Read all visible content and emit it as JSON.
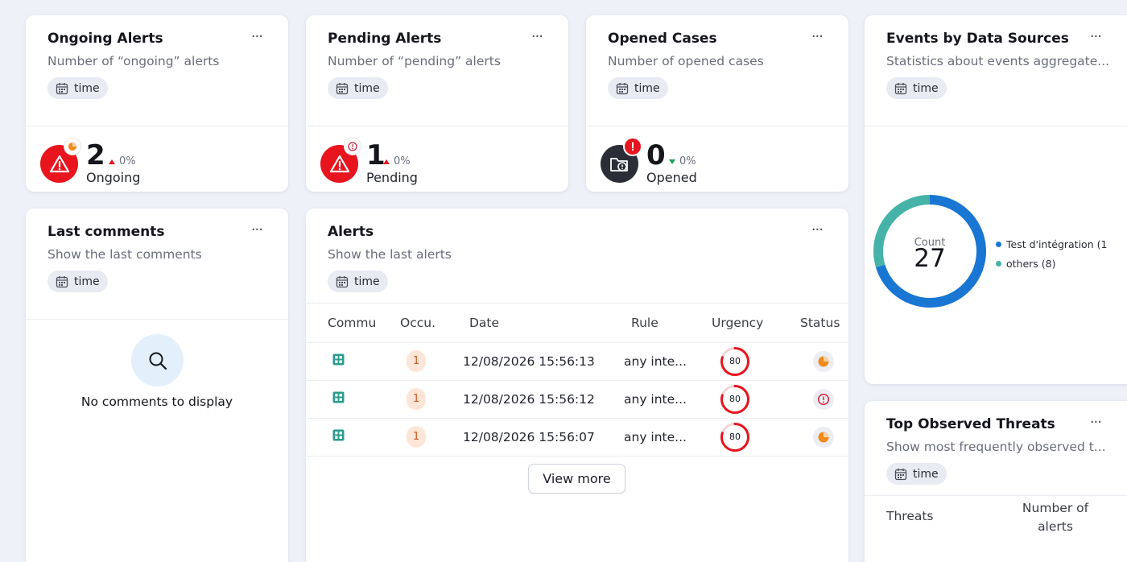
{
  "more_label": "···",
  "time_label": "time",
  "ongoing": {
    "title": "Ongoing Alerts",
    "subtitle": "Number of “ongoing” alerts",
    "value": "2",
    "trend": "0%",
    "label": "Ongoing",
    "color": "#e8141e"
  },
  "pending": {
    "title": "Pending Alerts",
    "subtitle": "Number of “pending” alerts",
    "value": "1",
    "trend": "0%",
    "label": "Pending",
    "color": "#e8141e"
  },
  "cases": {
    "title": "Opened Cases",
    "subtitle": "Number of opened cases",
    "value": "0",
    "trend": "0%",
    "label": "Opened",
    "color": "#2b2e36"
  },
  "events": {
    "title": "Events by Data Sources",
    "subtitle": "Statistics about events aggregate...",
    "donut_label": "Count",
    "donut_value": "27",
    "legend": [
      {
        "label": "Test d'intégration (1",
        "color": "#1976d2",
        "value": 19
      },
      {
        "label": "others (8)",
        "color": "#45b3a8",
        "value": 8
      }
    ]
  },
  "comments": {
    "title": "Last comments",
    "subtitle": "Show the last comments",
    "empty_text": "No comments to display"
  },
  "alerts": {
    "title": "Alerts",
    "subtitle": "Show the last alerts",
    "columns": [
      "Commu",
      "Occu.",
      "Date",
      "Rule",
      "Urgency",
      "Status"
    ],
    "rows": [
      {
        "occ": "1",
        "date": "12/08/2026 15:56:13",
        "rule": "any inte...",
        "urgency": "80",
        "status": "ongoing"
      },
      {
        "occ": "1",
        "date": "12/08/2026 15:56:12",
        "rule": "any inte...",
        "urgency": "80",
        "status": "pending"
      },
      {
        "occ": "1",
        "date": "12/08/2026 15:56:07",
        "rule": "any inte...",
        "urgency": "80",
        "status": "ongoing"
      }
    ],
    "view_more": "View more"
  },
  "threats": {
    "title": "Top Observed Threats",
    "subtitle": "Show most frequently observed t...",
    "col_threats": "Threats",
    "col_count": "Number of alerts"
  }
}
